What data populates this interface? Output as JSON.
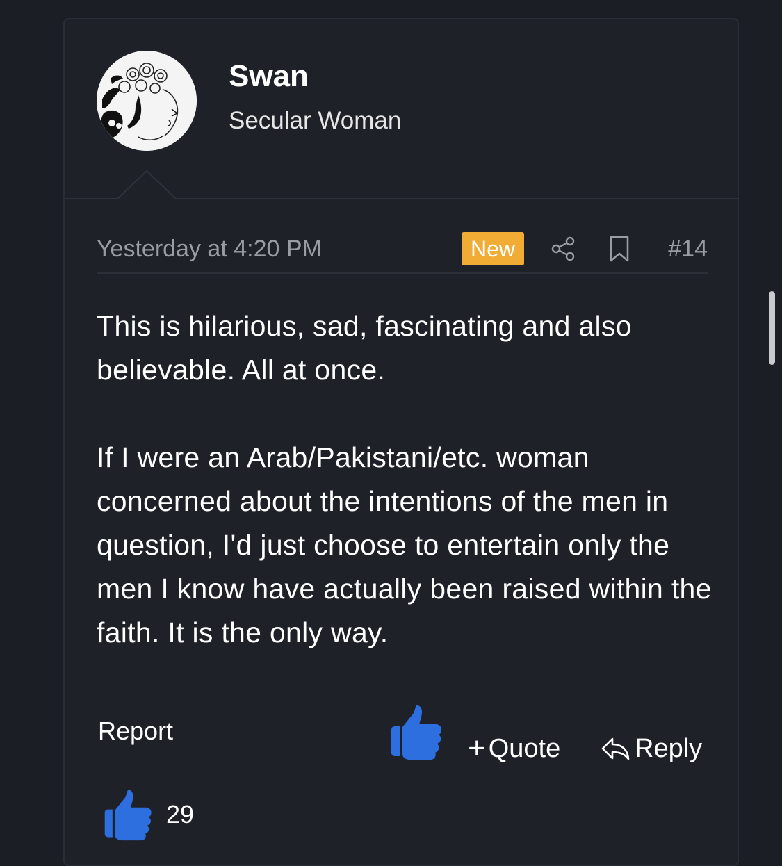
{
  "user": {
    "name": "Swan",
    "title": "Secular Woman"
  },
  "meta": {
    "timestamp": "Yesterday at 4:20 PM",
    "badge": "New",
    "post_number": "#14"
  },
  "body": {
    "paragraphs": [
      "This is hilarious, sad, fascinating and also believable. All at once.",
      "If I were an Arab/Pakistani/etc. woman concerned about the intentions of the men in question, I'd just choose to entertain only the men I know have actually been raised within the faith. It is the only way."
    ]
  },
  "actions": {
    "report_label": "Report",
    "quote_plus": "+",
    "quote_label": "Quote",
    "reply_label": "Reply"
  },
  "reactions": {
    "icon": "thumbs-up-icon",
    "count": "29"
  },
  "colors": {
    "background": "#1c1e25",
    "card": "#1f2129",
    "badge": "#f0ac34",
    "like": "#2e6fe0",
    "muted_text": "#9a9ca3"
  }
}
